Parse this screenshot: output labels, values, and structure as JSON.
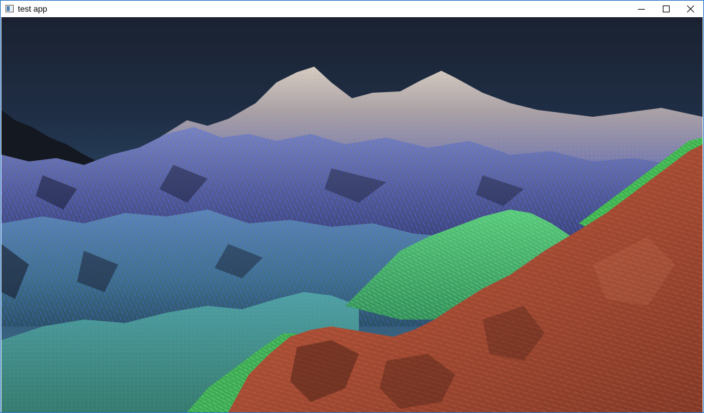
{
  "window": {
    "title": "test app",
    "icon": "app-window-icon"
  },
  "controls": {
    "minimize": "minimize-icon",
    "maximize": "maximize-icon",
    "close": "close-icon"
  },
  "scene": {
    "sky_top": "#1b2433",
    "sky_bottom": "#3d6a8a",
    "mesh_blue": "#3a5cf0",
    "mesh_green": "#3ed06a",
    "mesh_red": "#c9452b",
    "terrain_tan": "#b8a690"
  }
}
